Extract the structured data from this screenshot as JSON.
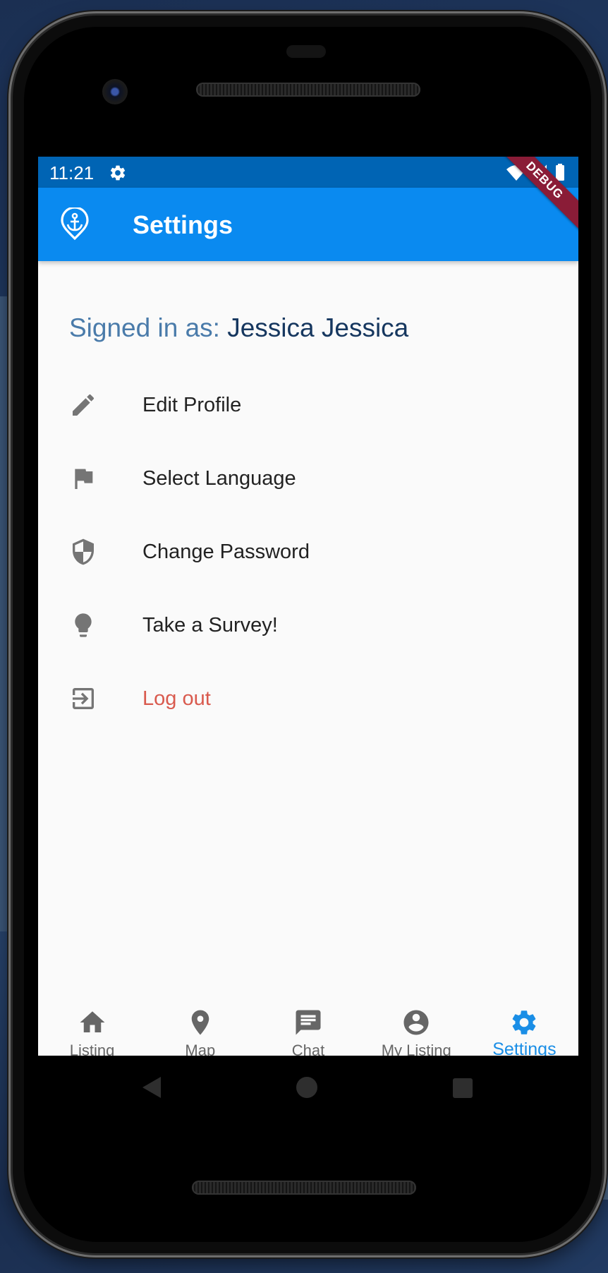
{
  "status_bar": {
    "time": "11:21",
    "icons": [
      "gear-icon",
      "wifi-icon",
      "signal-icon",
      "battery-icon"
    ]
  },
  "app_bar": {
    "title": "Settings",
    "logo_icon": "anchor-pin-icon",
    "debug_banner": "DEBUG"
  },
  "account": {
    "signed_in_label": "Signed in as: ",
    "user_name": "Jessica Jessica"
  },
  "menu": {
    "items": [
      {
        "label": "Edit Profile",
        "icon": "pencil-icon"
      },
      {
        "label": "Select Language",
        "icon": "flag-icon"
      },
      {
        "label": "Change Password",
        "icon": "shield-icon"
      },
      {
        "label": "Take a Survey!",
        "icon": "lightbulb-icon"
      },
      {
        "label": "Log out",
        "icon": "logout-icon",
        "color": "#d95a4e"
      }
    ]
  },
  "bottom_nav": {
    "items": [
      {
        "label": "Listing",
        "icon": "home-icon"
      },
      {
        "label": "Map",
        "icon": "map-pin-icon"
      },
      {
        "label": "Chat",
        "icon": "chat-icon"
      },
      {
        "label": "My Listing",
        "icon": "account-circle-icon"
      },
      {
        "label": "Settings",
        "icon": "settings-icon",
        "active": true
      }
    ]
  },
  "colors": {
    "status_bar": "#0064b4",
    "app_bar": "#0a8af0",
    "active_tab": "#1a8ee6",
    "logout_text": "#d95a4e",
    "signed_label": "#4a7baa",
    "signed_name": "#16375f"
  }
}
